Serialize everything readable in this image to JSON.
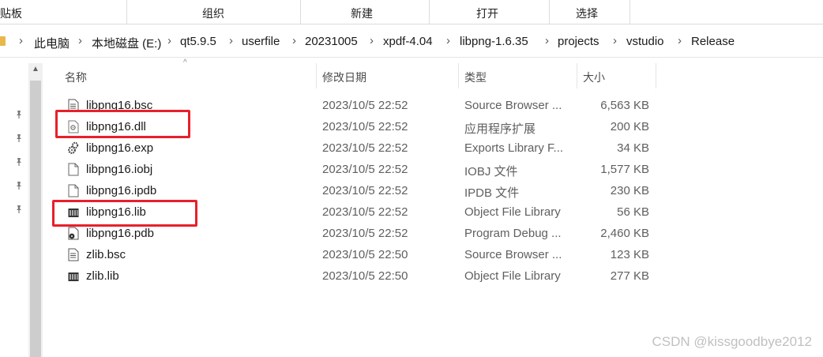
{
  "ribbon": {
    "groups": [
      "剪贴板",
      "组织",
      "新建",
      "打开",
      "选择"
    ]
  },
  "address": {
    "crumbs": [
      "此电脑",
      "本地磁盘 (E:)",
      "qt5.9.5",
      "userfile",
      "20231005",
      "xpdf-4.04",
      "libpng-1.6.35",
      "projects",
      "vstudio",
      "Release"
    ]
  },
  "columns": {
    "name": "名称",
    "date": "修改日期",
    "type": "类型",
    "size": "大小"
  },
  "files": [
    {
      "name": "libpng16.bsc",
      "date": "2023/10/5 22:52",
      "type": "Source Browser ...",
      "size": "6,563 KB",
      "icon": "document-icon",
      "highlighted": false
    },
    {
      "name": "libpng16.dll",
      "date": "2023/10/5 22:52",
      "type": "应用程序扩展",
      "size": "200 KB",
      "icon": "dll-gear-icon",
      "highlighted": true
    },
    {
      "name": "libpng16.exp",
      "date": "2023/10/5 22:52",
      "type": "Exports Library F...",
      "size": "34 KB",
      "icon": "gears-icon",
      "highlighted": false
    },
    {
      "name": "libpng16.iobj",
      "date": "2023/10/5 22:52",
      "type": "IOBJ 文件",
      "size": "1,577 KB",
      "icon": "blank-file-icon",
      "highlighted": false
    },
    {
      "name": "libpng16.ipdb",
      "date": "2023/10/5 22:52",
      "type": "IPDB 文件",
      "size": "230 KB",
      "icon": "blank-file-icon",
      "highlighted": false
    },
    {
      "name": "libpng16.lib",
      "date": "2023/10/5 22:52",
      "type": "Object File Library",
      "size": "56 KB",
      "icon": "library-icon",
      "highlighted": true
    },
    {
      "name": "libpng16.pdb",
      "date": "2023/10/5 22:52",
      "type": "Program Debug ...",
      "size": "2,460 KB",
      "icon": "debug-file-icon",
      "highlighted": false
    },
    {
      "name": "zlib.bsc",
      "date": "2023/10/5 22:50",
      "type": "Source Browser ...",
      "size": "123 KB",
      "icon": "document-icon",
      "highlighted": false
    },
    {
      "name": "zlib.lib",
      "date": "2023/10/5 22:50",
      "type": "Object File Library",
      "size": "277 KB",
      "icon": "library-icon",
      "highlighted": false
    }
  ],
  "watermark": "CSDN @kissgoodbye2012",
  "colors": {
    "highlight": "#e8202b",
    "folder": "#e8b84a"
  }
}
